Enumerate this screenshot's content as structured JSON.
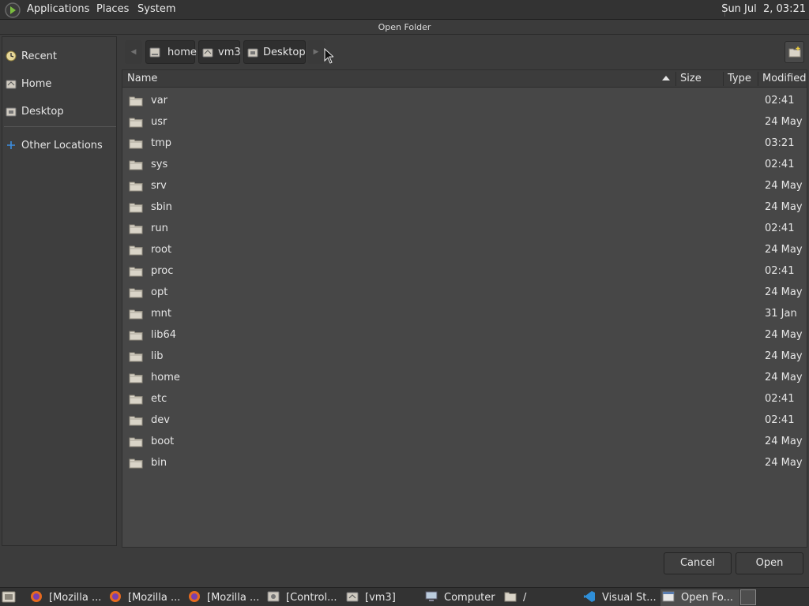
{
  "top_panel": {
    "menus": [
      "Applications",
      "Places",
      "System"
    ],
    "clock": "Sun Jul  2, 03:21"
  },
  "dialog": {
    "title": "Open Folder",
    "sidebar": {
      "items": [
        {
          "label": "Recent",
          "icon": "recent-icon"
        },
        {
          "label": "Home",
          "icon": "home-icon"
        },
        {
          "label": "Desktop",
          "icon": "desktop-icon"
        },
        {
          "label": "Other Locations",
          "icon": "plus-icon"
        }
      ]
    },
    "path": [
      "home",
      "vm3",
      "Desktop"
    ],
    "columns": {
      "name": "Name",
      "size": "Size",
      "type": "Type",
      "modified": "Modified"
    },
    "files": [
      {
        "name": "var",
        "modified": "02:41"
      },
      {
        "name": "usr",
        "modified": "24 May"
      },
      {
        "name": "tmp",
        "modified": "03:21"
      },
      {
        "name": "sys",
        "modified": "02:41"
      },
      {
        "name": "srv",
        "modified": "24 May"
      },
      {
        "name": "sbin",
        "modified": "24 May"
      },
      {
        "name": "run",
        "modified": "02:41"
      },
      {
        "name": "root",
        "modified": "24 May"
      },
      {
        "name": "proc",
        "modified": "02:41"
      },
      {
        "name": "opt",
        "modified": "24 May"
      },
      {
        "name": "mnt",
        "modified": "31 Jan"
      },
      {
        "name": "lib64",
        "modified": "24 May"
      },
      {
        "name": "lib",
        "modified": "24 May"
      },
      {
        "name": "home",
        "modified": "24 May"
      },
      {
        "name": "etc",
        "modified": "02:41"
      },
      {
        "name": "dev",
        "modified": "02:41"
      },
      {
        "name": "boot",
        "modified": "24 May"
      },
      {
        "name": "bin",
        "modified": "24 May"
      }
    ],
    "buttons": {
      "cancel": "Cancel",
      "open": "Open"
    }
  },
  "taskbar": {
    "tasks": [
      {
        "label": "[Mozilla ...",
        "icon": "firefox-icon"
      },
      {
        "label": "[Mozilla ...",
        "icon": "firefox-icon"
      },
      {
        "label": "[Mozilla ...",
        "icon": "firefox-icon"
      },
      {
        "label": "[Control...",
        "icon": "control-center-icon"
      },
      {
        "label": "[vm3]",
        "icon": "home-folder-icon"
      },
      {
        "label": "Computer",
        "icon": "computer-icon"
      },
      {
        "label": "/",
        "icon": "folder-icon"
      },
      {
        "label": "Visual St...",
        "icon": "vscode-icon"
      },
      {
        "label": "Open Fo...",
        "icon": "window-icon"
      }
    ]
  },
  "colors": {
    "panel": "#333333",
    "window": "#3c3c3c",
    "list": "#474747",
    "folder": "#d9d4c8",
    "accent_blue": "#3d8ee0"
  }
}
